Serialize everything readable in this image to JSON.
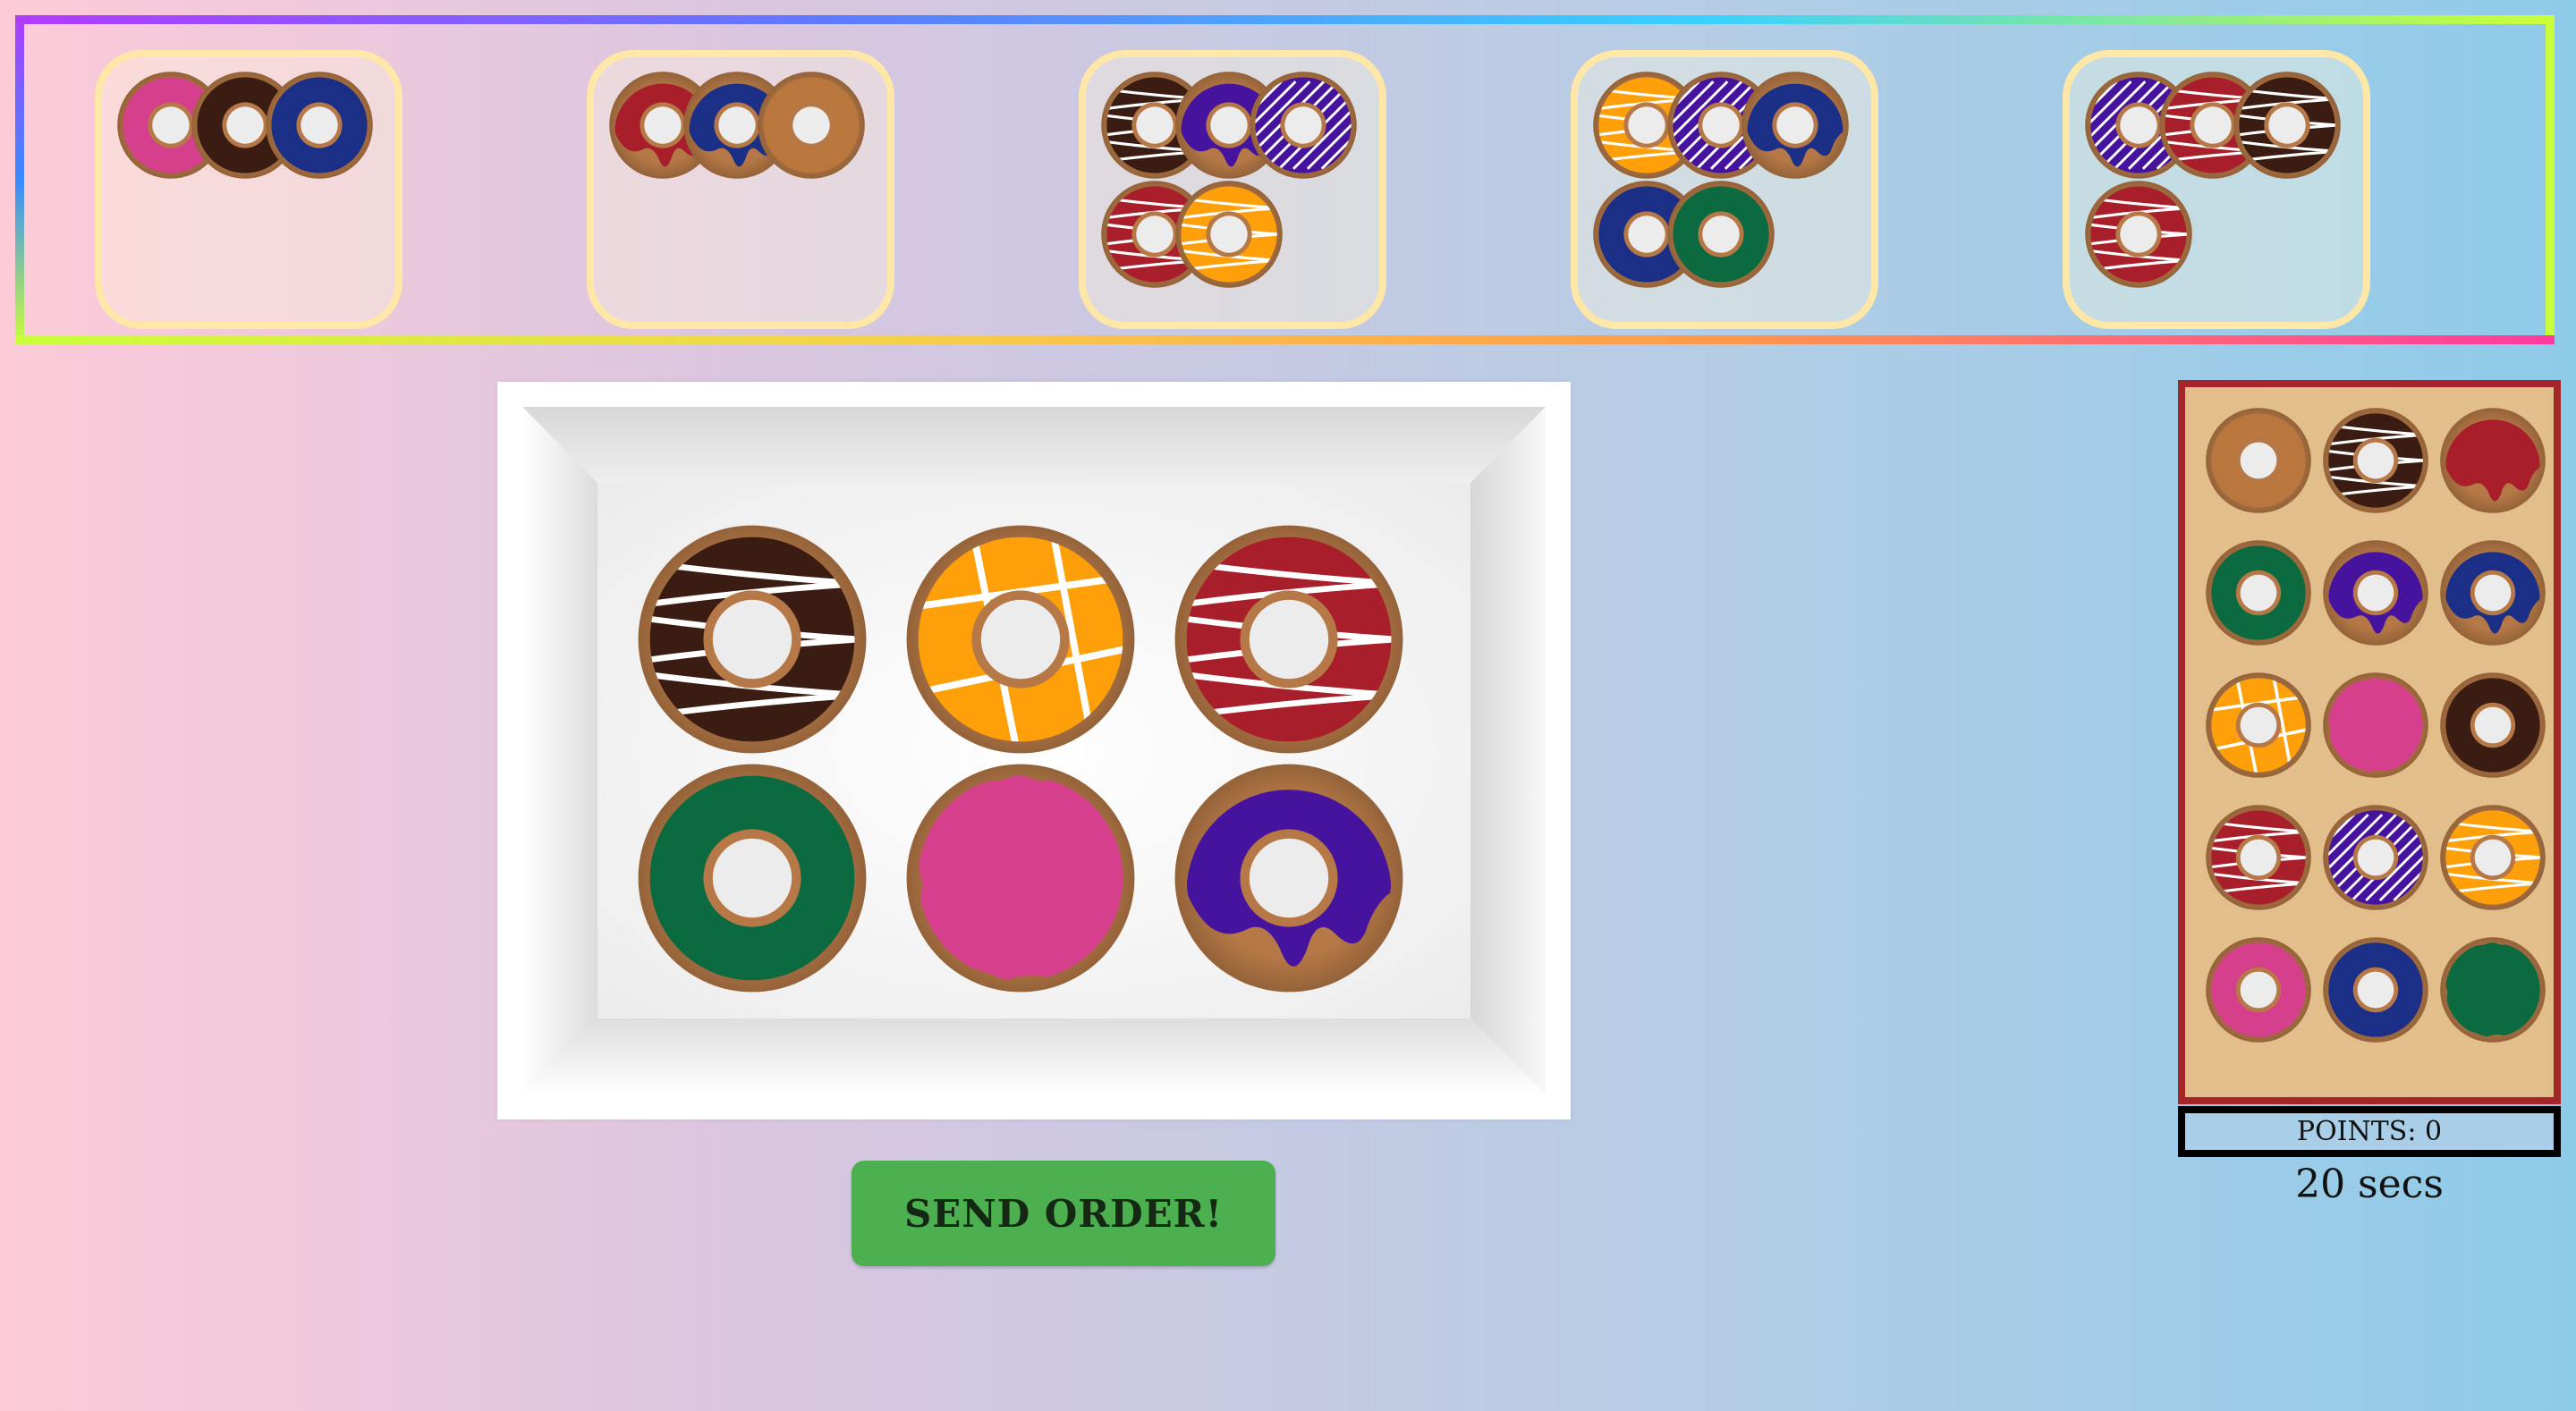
{
  "colors": {
    "pink": "#d63f8c",
    "chocolate": "#3a1c12",
    "navy": "#1c2f86",
    "red": "#a81e2a",
    "tan": "#b9773e",
    "purple": "#45139e",
    "orange": "#ffa00a",
    "green": "#0b6a3f",
    "dough": "#b57846"
  },
  "orders": [
    {
      "donuts": [
        {
          "glaze": "pink",
          "style": "plain",
          "dough": "hole"
        },
        {
          "glaze": "chocolate",
          "style": "plain",
          "dough": "hole"
        },
        {
          "glaze": "navy",
          "style": "plain",
          "dough": "hole"
        }
      ]
    },
    {
      "donuts": [
        {
          "glaze": "red",
          "style": "drip",
          "dough": "hole"
        },
        {
          "glaze": "navy",
          "style": "drip",
          "dough": "hole"
        },
        {
          "glaze": "tan",
          "style": "plain",
          "dough": "hole"
        }
      ]
    },
    {
      "donuts": [
        {
          "glaze": "chocolate",
          "style": "stripes",
          "dough": "hole"
        },
        {
          "glaze": "purple",
          "style": "drip",
          "dough": "hole"
        },
        {
          "glaze": "purple",
          "style": "diagonal",
          "dough": "hole"
        },
        {
          "glaze": "red",
          "style": "stripes",
          "dough": "hole"
        },
        {
          "glaze": "orange",
          "style": "stripes",
          "dough": "hole"
        }
      ]
    },
    {
      "donuts": [
        {
          "glaze": "orange",
          "style": "stripes",
          "dough": "hole"
        },
        {
          "glaze": "purple",
          "style": "diagonal",
          "dough": "hole"
        },
        {
          "glaze": "navy",
          "style": "drip",
          "dough": "hole"
        },
        {
          "glaze": "navy",
          "style": "plain",
          "dough": "hole"
        },
        {
          "glaze": "green",
          "style": "plain",
          "dough": "hole"
        }
      ]
    },
    {
      "donuts": [
        {
          "glaze": "purple",
          "style": "diagonal",
          "dough": "hole"
        },
        {
          "glaze": "red",
          "style": "stripes",
          "dough": "hole"
        },
        {
          "glaze": "chocolate",
          "style": "stripes",
          "dough": "hole"
        },
        {
          "glaze": "red",
          "style": "stripes",
          "dough": "hole"
        }
      ]
    }
  ],
  "box": {
    "donuts": [
      {
        "glaze": "chocolate",
        "style": "stripes",
        "dough": "hole"
      },
      {
        "glaze": "orange",
        "style": "cross",
        "dough": "nohole"
      },
      {
        "glaze": "red",
        "style": "stripes",
        "dough": "hole"
      },
      {
        "glaze": "green",
        "style": "plain",
        "dough": "hole"
      },
      {
        "glaze": "pink",
        "style": "plain",
        "dough": "filled"
      },
      {
        "glaze": "purple",
        "style": "drip",
        "dough": "nohole"
      }
    ]
  },
  "tray": {
    "donuts": [
      {
        "glaze": "tan",
        "style": "plain",
        "dough": "hole"
      },
      {
        "glaze": "chocolate",
        "style": "stripes",
        "dough": "hole"
      },
      {
        "glaze": "red",
        "style": "drip",
        "dough": "filled"
      },
      {
        "glaze": "green",
        "style": "plain",
        "dough": "hole"
      },
      {
        "glaze": "purple",
        "style": "drip",
        "dough": "hole"
      },
      {
        "glaze": "navy",
        "style": "drip",
        "dough": "hole"
      },
      {
        "glaze": "orange",
        "style": "cross",
        "dough": "nohole"
      },
      {
        "glaze": "pink",
        "style": "plain",
        "dough": "filled"
      },
      {
        "glaze": "chocolate",
        "style": "plain",
        "dough": "hole"
      },
      {
        "glaze": "red",
        "style": "stripes",
        "dough": "hole"
      },
      {
        "glaze": "purple",
        "style": "diagonal",
        "dough": "hole"
      },
      {
        "glaze": "orange",
        "style": "stripes",
        "dough": "hole"
      },
      {
        "glaze": "pink",
        "style": "plain",
        "dough": "hole"
      },
      {
        "glaze": "navy",
        "style": "plain",
        "dough": "hole"
      },
      {
        "glaze": "green",
        "style": "plain",
        "dough": "filled"
      }
    ]
  },
  "controls": {
    "send_label": "SEND ORDER!"
  },
  "status": {
    "points_label": "POINTS: 0",
    "timer_label": "20 secs"
  }
}
